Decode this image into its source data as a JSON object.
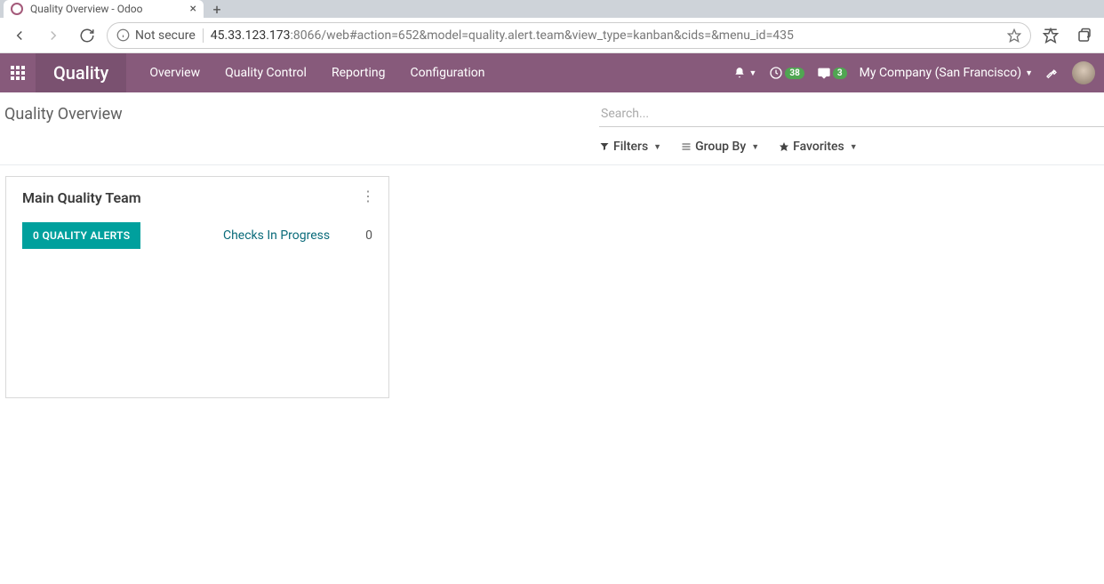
{
  "browser": {
    "tab_title": "Quality Overview - Odoo",
    "not_secure_label": "Not secure",
    "url_host": "45.33.123.173",
    "url_path": ":8066/web#action=652&model=quality.alert.team&view_type=kanban&cids=&menu_id=435"
  },
  "nav": {
    "app_name": "Quality",
    "menu": [
      "Overview",
      "Quality Control",
      "Reporting",
      "Configuration"
    ],
    "activities_badge": "38",
    "messages_badge": "3",
    "company": "My Company (San Francisco)"
  },
  "control": {
    "breadcrumb": "Quality Overview",
    "search_placeholder": "Search...",
    "filters_label": "Filters",
    "groupby_label": "Group By",
    "favorites_label": "Favorites"
  },
  "card": {
    "title": "Main Quality Team",
    "alerts_button": "0 QUALITY ALERTS",
    "checks_label": "Checks In Progress",
    "checks_count": "0"
  }
}
